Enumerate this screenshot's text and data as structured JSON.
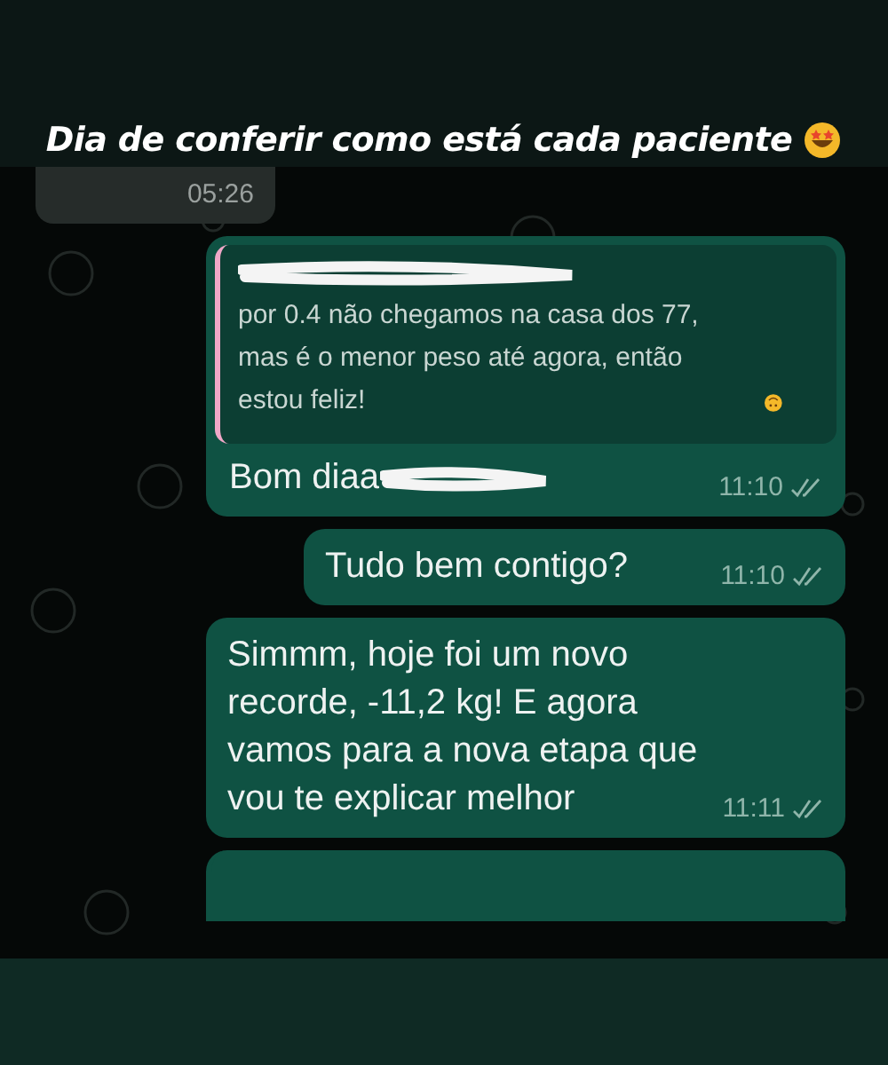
{
  "caption": "Dia de conferir como está cada paciente",
  "messages": [
    {
      "kind": "received",
      "time": "05:26"
    },
    {
      "kind": "sent",
      "quote": "por 0.4 não chegamos na casa dos 77, mas é o menor peso até agora, então estou feliz!",
      "text": "Bom diaa",
      "time": "11:10"
    },
    {
      "kind": "sent",
      "text": "Tudo bem contigo?",
      "time": "11:10"
    },
    {
      "kind": "sent",
      "text": "Simmm, hoje foi um novo recorde, -11,2 kg! E agora vamos para a nova etapa que vou te explicar melhor",
      "time": "11:11"
    },
    {
      "kind": "cut"
    }
  ]
}
